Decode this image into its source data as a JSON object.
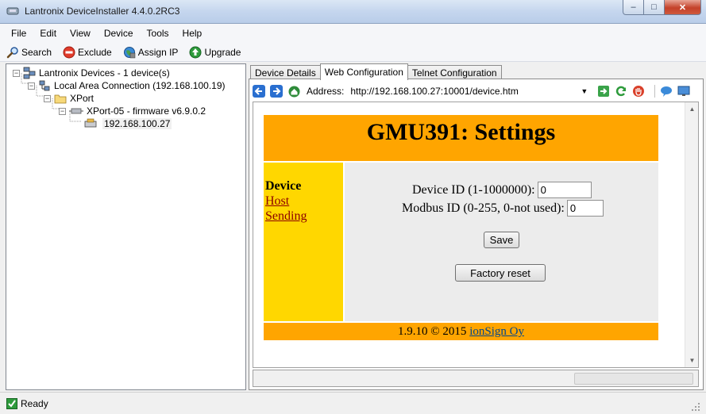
{
  "window": {
    "title": "Lantronix DeviceInstaller 4.4.0.2RC3",
    "controls": {
      "minimize": "‒",
      "maximize": "□",
      "close": "✕"
    }
  },
  "menu": [
    "File",
    "Edit",
    "View",
    "Device",
    "Tools",
    "Help"
  ],
  "toolbar": {
    "search": "Search",
    "exclude": "Exclude",
    "assign_ip": "Assign IP",
    "upgrade": "Upgrade"
  },
  "tree": {
    "root": "Lantronix Devices - 1 device(s)",
    "connection": "Local Area Connection (192.168.100.19)",
    "folder": "XPort",
    "device": "XPort-05 - firmware v6.9.0.2",
    "ip": "192.168.100.27",
    "expand_symbol": "−"
  },
  "tabs": [
    "Device Details",
    "Web Configuration",
    "Telnet Configuration"
  ],
  "active_tab": "Web Configuration",
  "address": {
    "label": "Address:",
    "value": "http://192.168.100.27:10001/device.htm",
    "dropdown": "▼"
  },
  "web_page": {
    "title": "GMU391: Settings",
    "side_title": "Device",
    "side_links": [
      "Host",
      "Sending"
    ],
    "device_id_label": "Device ID (1-1000000):",
    "device_id_value": "0",
    "modbus_id_label": "Modbus ID (0-255, 0-not used):",
    "modbus_id_value": "0",
    "save_button": "Save",
    "factory_reset_button": "Factory reset",
    "footer_text": "1.9.10 © 2015 ",
    "footer_link": "ionSign Oy"
  },
  "scroll": {
    "up": "▲",
    "down": "▼"
  },
  "status": {
    "text": "Ready"
  },
  "colors": {
    "header_orange": "#ffa500",
    "sidebar_yellow": "#ffd700",
    "main_gray": "#ececec",
    "link_red": "#8b0000",
    "footer_link_blue": "#00468c"
  }
}
